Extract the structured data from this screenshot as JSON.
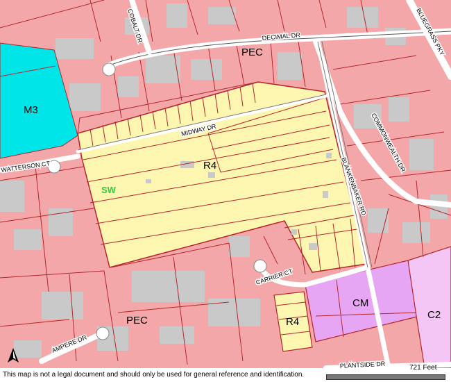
{
  "zones": {
    "m3": "M3",
    "pec_north": "PEC",
    "r4_main": "R4",
    "sw": "SW",
    "pec_south": "PEC",
    "r4_south": "R4",
    "cm": "CM",
    "c2": "C2"
  },
  "streets": {
    "cobalt": "COBALT DR",
    "decimal": "DECIMAL DR",
    "bluegrass": "BLUEGRASS PKY",
    "midway": "MIDWAY DR",
    "watterson": "WATTERSON CT",
    "commonwealth": "COMMONWEALTH DR",
    "blankenbaker": "BLANKENBAKER RD",
    "carrier": "CARRIER CT",
    "ampere": "AMPERE DR",
    "plantside": "PLANTSIDE DR"
  },
  "footer": {
    "disclaimer": "This map is not a legal document and should only be used for general reference and identification.",
    "scale": "721 Feet"
  },
  "colors": {
    "pec": "#f4a7a9",
    "m3": "#00e5e8",
    "r4": "#fcf6b0",
    "cm": "#e7a6f4",
    "c2": "#f3c6f6",
    "building": "#c9c9c9",
    "parcel_line": "#b3262b",
    "road": "#ffffff"
  }
}
